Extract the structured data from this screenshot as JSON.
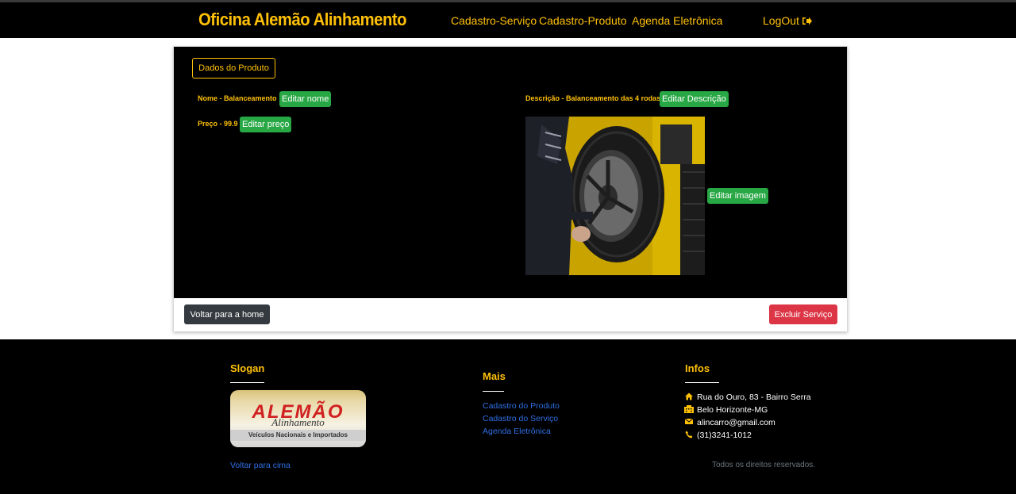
{
  "navbar": {
    "brand": "Oficina Alemão Alinhamento",
    "links": [
      "Cadastro-Serviço",
      "Cadastro-Produto",
      "Agenda Eletrônica"
    ],
    "logout_label": "LogOut",
    "logout_icon": "sign-out-icon"
  },
  "card": {
    "tab_label": "Dados do Produto",
    "nome_label": "Nome - Balanceamento",
    "edit_nome": "Editar nome",
    "preco_label": "Preço - 99.9",
    "edit_preco": "Editar preço",
    "descricao_label": "Descrição - Balanceamento das 4 rodas",
    "edit_descricao": "Editar Descrição",
    "edit_imagem": "Editar imagem",
    "back_button": "Voltar para a home",
    "delete_button": "Excluir Serviço"
  },
  "footer": {
    "slogan_heading": "Slogan",
    "logo_text": "ALEMÃO",
    "logo_subtext": "Alinhamento",
    "logo_bar_text": "Veículos Nacionais e Importados",
    "back_to_top": "Voltar para cima",
    "mais_heading": "Mais",
    "mais_links": [
      "Cadastro do Produto",
      "Cadastro do Serviço",
      "Agenda Eletrônica"
    ],
    "infos_heading": "Infos",
    "infos": [
      {
        "icon": "home-icon",
        "text": "Rua do Ouro, 83 - Bairro Serra"
      },
      {
        "icon": "building-icon",
        "text": "Belo Horizonte-MG"
      },
      {
        "icon": "envelope-icon",
        "text": "alincarro@gmail.com"
      },
      {
        "icon": "phone-icon",
        "text": "(31)3241-1012"
      }
    ],
    "rights": "Todos os direitos reservados."
  },
  "colors": {
    "accent": "#ffc107",
    "success": "#28a745",
    "danger": "#dc3545",
    "dark": "#343a40",
    "link": "#2f6fe4"
  }
}
